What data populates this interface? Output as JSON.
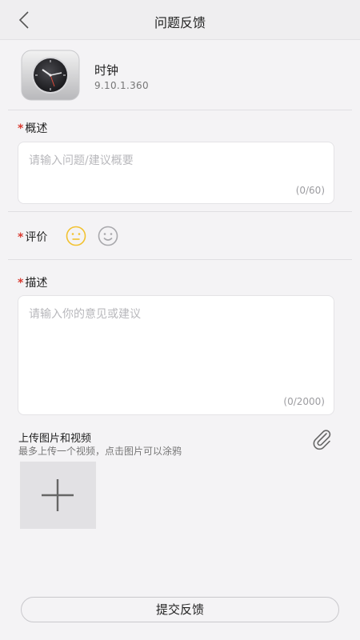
{
  "header": {
    "title": "问题反馈"
  },
  "app": {
    "name": "时钟",
    "version": "9.10.1.360"
  },
  "summary": {
    "label": "概述",
    "placeholder": "请输入问题/建议概要",
    "counter": "(0/60)"
  },
  "rating": {
    "label": "评价",
    "options": [
      "neutral-face",
      "smiley-face"
    ],
    "selected_color": "#f2c230"
  },
  "description": {
    "label": "描述",
    "placeholder": "请输入你的意见或建议",
    "counter": "(0/2000)"
  },
  "upload": {
    "title": "上传图片和视频",
    "hint": "最多上传一个视频，点击图片可以涂鸦"
  },
  "submit": {
    "label": "提交反馈"
  },
  "colors": {
    "required": "#d9392f",
    "background": "#f4f3f5"
  }
}
